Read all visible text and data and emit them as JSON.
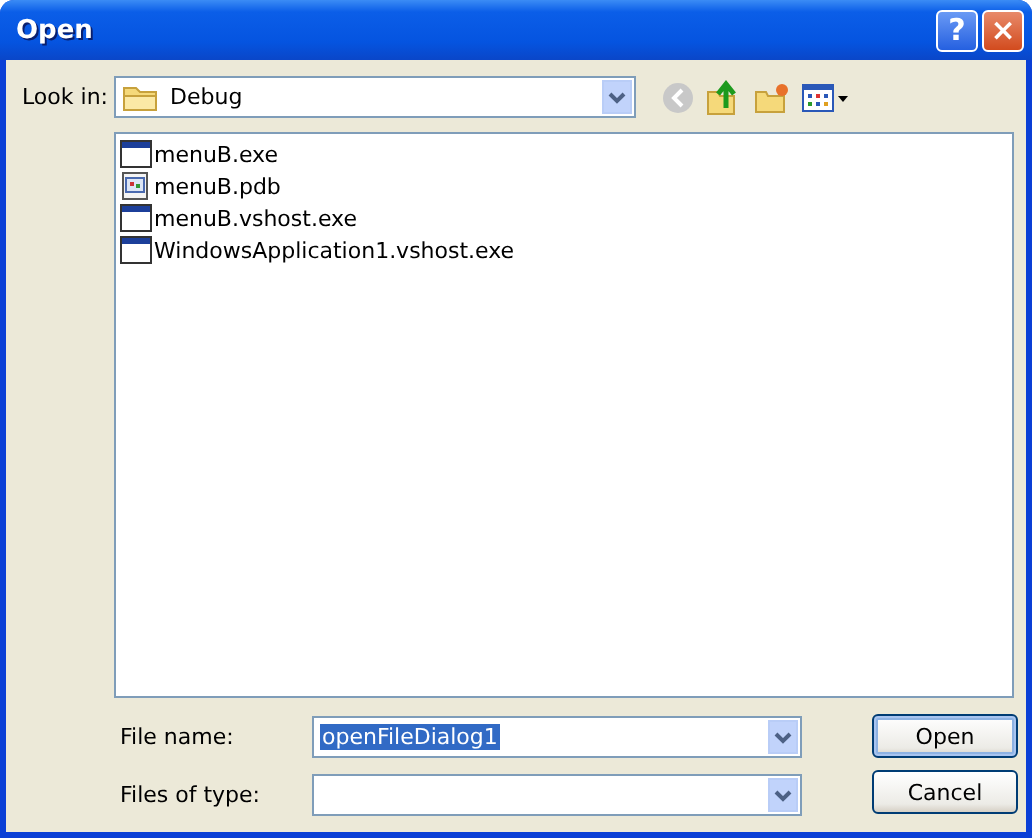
{
  "window": {
    "title": "Open",
    "buttons": [
      {
        "kind": "help",
        "label": "?"
      },
      {
        "kind": "close",
        "label": "×"
      }
    ]
  },
  "look_in": {
    "label": "Look in:",
    "value": "Debug"
  },
  "files": [
    {
      "name": "menuB.exe",
      "kind": "exe"
    },
    {
      "name": "menuB.pdb",
      "kind": "pdb"
    },
    {
      "name": "menuB.vshost.exe",
      "kind": "exe"
    },
    {
      "name": "WindowsApplication1.vshost.exe",
      "kind": "exe"
    }
  ],
  "file_name": {
    "label": "File name:",
    "value": "openFileDialog1",
    "selected": true
  },
  "file_type": {
    "label": "Files of type:"
  },
  "buttons": [
    "Open",
    "Cancel"
  ]
}
